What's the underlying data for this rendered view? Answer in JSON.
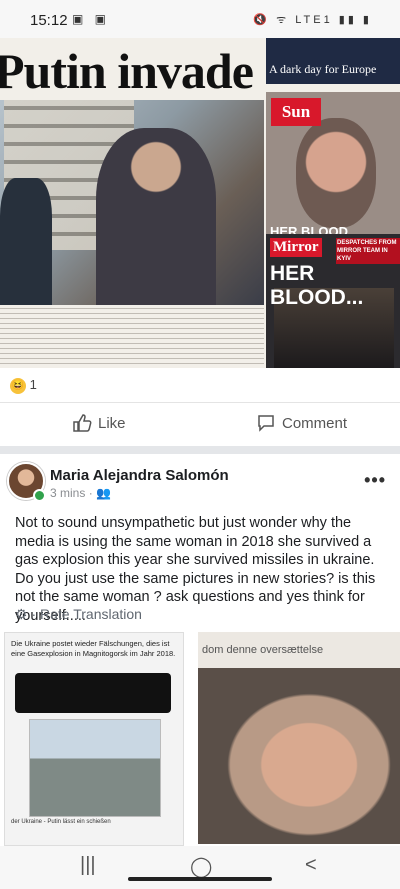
{
  "status_bar": {
    "time": "15:12",
    "left_icons": "▣ ▣",
    "right_icons": "🔇 ᯤ LTE1 ▮▮ ▮"
  },
  "post_image": {
    "headline": "Putin invade",
    "guardian_label": "A dark day for Europe",
    "sun_logo": "Sun",
    "sun_headline": "HER BLOOD",
    "mirror_logo": "Mirror",
    "mirror_sub": "DESPATCHES FROM MIRROR TEAM IN KYIV",
    "mirror_headline": "HER BLOOD..."
  },
  "reactions": {
    "count": "1"
  },
  "actions": {
    "like_label": "Like",
    "comment_label": "Comment"
  },
  "comment": {
    "author": "Maria Alejandra Salomón",
    "time": "3 mins",
    "text": "Not to sound unsympathetic but just wonder why the media is using the same woman in 2018 she survived a gas explosion this year she survived missiles in ukraine. Do you just use the same pictures in new stories? is this not the same woman ? ask questions and yes think for yourself.....",
    "translate_label": "Rate Translation"
  },
  "attachment": {
    "left_text": "Die Ukraine postet wieder Fälschungen, dies ist eine Gasexplosion in Magnitogorsk im Jahr 2018.",
    "left_caption": "der Ukraine - Putin lässt ein schießen",
    "right_text": "dom denne oversættelse"
  }
}
